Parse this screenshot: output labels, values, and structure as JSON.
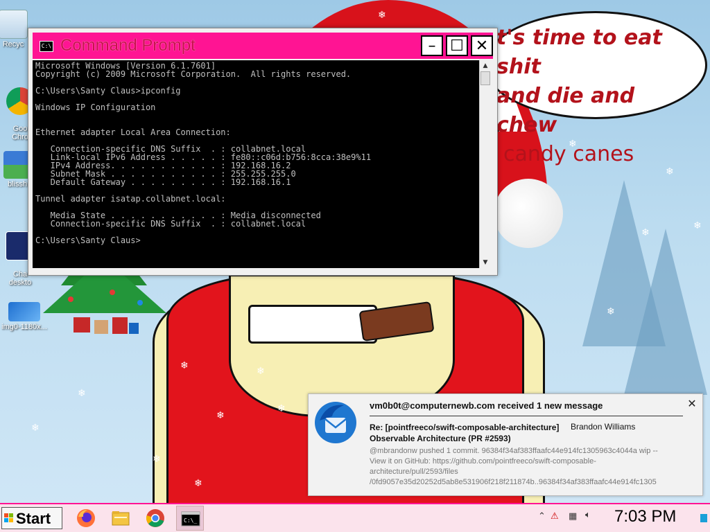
{
  "wallpaper": {
    "speech_bubble": {
      "line1": "t's time to eat shit",
      "line2": "and die and chew",
      "line3": "candy canes"
    }
  },
  "desktop_icons": [
    {
      "label": "Recyc",
      "icon": "recycle-bin-icon"
    },
    {
      "label": "Goo\nChro",
      "icon": "chrome-icon"
    },
    {
      "label": "blissh",
      "icon": "image-file-icon"
    },
    {
      "label": "Cha\ndeskto",
      "icon": "shortcut-icon"
    },
    {
      "label": "img0-1180x...",
      "icon": "image-file-icon"
    }
  ],
  "cmd_window": {
    "title": "Command Prompt",
    "buttons": {
      "minimize": "–",
      "maximize": "☐",
      "close": "✕"
    },
    "lines": [
      "Microsoft Windows [Version 6.1.7601]",
      "Copyright (c) 2009 Microsoft Corporation.  All rights reserved.",
      "",
      "C:\\Users\\Santy Claus>ipconfig",
      "",
      "Windows IP Configuration",
      "",
      "",
      "Ethernet adapter Local Area Connection:",
      "",
      "   Connection-specific DNS Suffix  . : collabnet.local",
      "   Link-local IPv6 Address . . . . . : fe80::c06d:b756:8cca:38e9%11",
      "   IPv4 Address. . . . . . . . . . . : 192.168.16.2",
      "   Subnet Mask . . . . . . . . . . . : 255.255.255.0",
      "   Default Gateway . . . . . . . . . : 192.168.16.1",
      "",
      "Tunnel adapter isatap.collabnet.local:",
      "",
      "   Media State . . . . . . . . . . . : Media disconnected",
      "   Connection-specific DNS Suffix  . : collabnet.local",
      "",
      "C:\\Users\\Santy Claus>"
    ]
  },
  "notification": {
    "heading": "vm0b0t@computernewb.com received 1 new message",
    "subject": "Re: [pointfreeco/swift-composable-architecture] Observable Architecture (PR #2593)",
    "sender": "Brandon Williams",
    "preview": "@mbrandonw pushed 1 commit. 96384f34af383ffaafc44e914fc1305963c4044a wip -- View it on GitHub: https://github.com/pointfreeco/swift-composable-architecture/pull/2593/files /0fd9057e35d20252d5ab8e531906f218f211874b..96384f34af383ffaafc44e914fc1305",
    "close": "✕"
  },
  "taskbar": {
    "start_label": "Start",
    "pinned": [
      "firefox-icon",
      "file-explorer-icon",
      "chrome-icon",
      "command-prompt-icon"
    ],
    "tray_icons": [
      "chevron-up-icon",
      "network-alert-icon",
      "action-center-icon",
      "volume-icon"
    ],
    "clock": "7:03 PM"
  },
  "colors": {
    "title_bar": "#ff1493",
    "title_text": "#c8104d",
    "taskbar_border": "#ff1493",
    "console_bg": "#000000",
    "console_fg": "#c0c0c0"
  }
}
